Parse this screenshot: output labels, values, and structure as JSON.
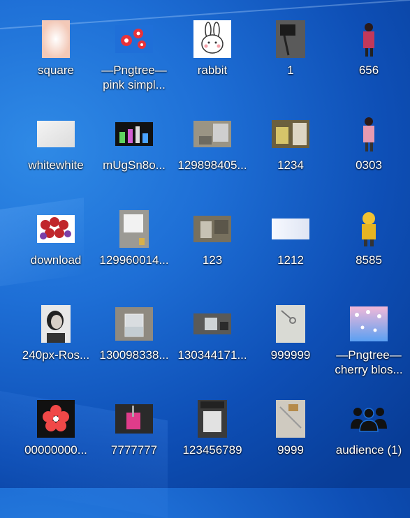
{
  "desktop": {
    "icons": [
      {
        "line1": "square",
        "line2": ""
      },
      {
        "line1": "—Pngtree—",
        "line2": "pink simpl..."
      },
      {
        "line1": "rabbit",
        "line2": ""
      },
      {
        "line1": "1",
        "line2": ""
      },
      {
        "line1": "656",
        "line2": ""
      },
      {
        "line1": "whitewhite",
        "line2": ""
      },
      {
        "line1": "mUgSn8o...",
        "line2": ""
      },
      {
        "line1": "129898405...",
        "line2": ""
      },
      {
        "line1": "1234",
        "line2": ""
      },
      {
        "line1": "0303",
        "line2": ""
      },
      {
        "line1": "download",
        "line2": ""
      },
      {
        "line1": "129960014...",
        "line2": ""
      },
      {
        "line1": "123",
        "line2": ""
      },
      {
        "line1": "1212",
        "line2": ""
      },
      {
        "line1": "8585",
        "line2": ""
      },
      {
        "line1": "240px-Ros...",
        "line2": ""
      },
      {
        "line1": "130098338...",
        "line2": ""
      },
      {
        "line1": "130344171...",
        "line2": ""
      },
      {
        "line1": "999999",
        "line2": ""
      },
      {
        "line1": "—Pngtree—",
        "line2": "cherry blos..."
      },
      {
        "line1": "00000000...",
        "line2": ""
      },
      {
        "line1": "7777777",
        "line2": ""
      },
      {
        "line1": "123456789",
        "line2": ""
      },
      {
        "line1": "9999",
        "line2": ""
      },
      {
        "line1": "audience (1)",
        "line2": ""
      }
    ]
  },
  "colors": {
    "wallpaper": "#1e6fd6",
    "label_text": "#ffffff"
  }
}
